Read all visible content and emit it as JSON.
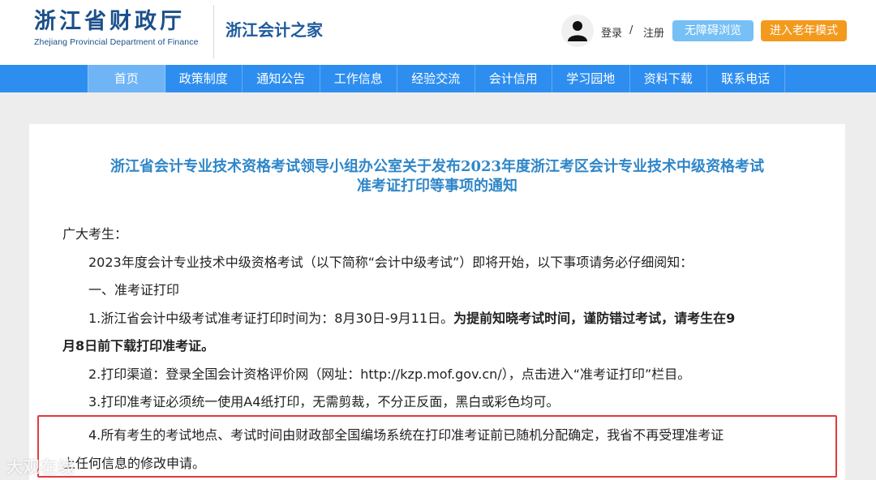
{
  "header": {
    "logo_cn": "浙江省财政厅",
    "logo_en": "Zhejiang Provincial Department of Finance",
    "site_name": "浙江会计之家",
    "login": "登录",
    "separator": "/",
    "register": "注册",
    "accessible_button": "无障碍浏览",
    "elder_mode_button": "进入老年模式"
  },
  "nav": {
    "items": [
      "首页",
      "政策制度",
      "通知公告",
      "工作信息",
      "经验交流",
      "会计信用",
      "学习园地",
      "资料下载",
      "联系电话"
    ],
    "active_index": 0
  },
  "article": {
    "title_line1": "浙江省会计专业技术资格考试领导小组办公室关于发布2023年度浙江考区会计专业技术中级资格考试",
    "title_line2": "准考证打印等事项的通知",
    "greeting": "广大考生：",
    "intro": "2023年度会计专业技术中级资格考试（以下简称“会计中级考试”）即将开始，以下事项请务必仔细阅知：",
    "section1": "一、准考证打印",
    "item1_normal": "1.浙江省会计中级考试准考证打印时间为：8月30日-9月11日。",
    "item1_bold_a": "为提前知晓考试时间，谨防错过考试，请考生在9",
    "item1_bold_b": "月8日前下载打印准考证。",
    "item2": "2.打印渠道：登录全国会计资格评价网（网址：http://kzp.mof.gov.cn/），点击进入“准考证打印”栏目。",
    "item3": "3.打印准考证必须统一使用A4纸打印，无需剪裁，不分正反面，黑白或彩色均可。",
    "item4_line1": "4.所有考生的考试地点、考试时间由财政部全国编场系统在打印准考证前已随机分配确定，我省不再受理准考证",
    "item4_line2": "上任何信息的修改申请。"
  },
  "watermark": "大观在线",
  "colors": {
    "nav_bg": "#2e8ef0",
    "title": "#2f86c8",
    "highlight_border": "#e23a3a",
    "elder_button": "#f39a1d",
    "accessible_button": "#76c0f5"
  }
}
